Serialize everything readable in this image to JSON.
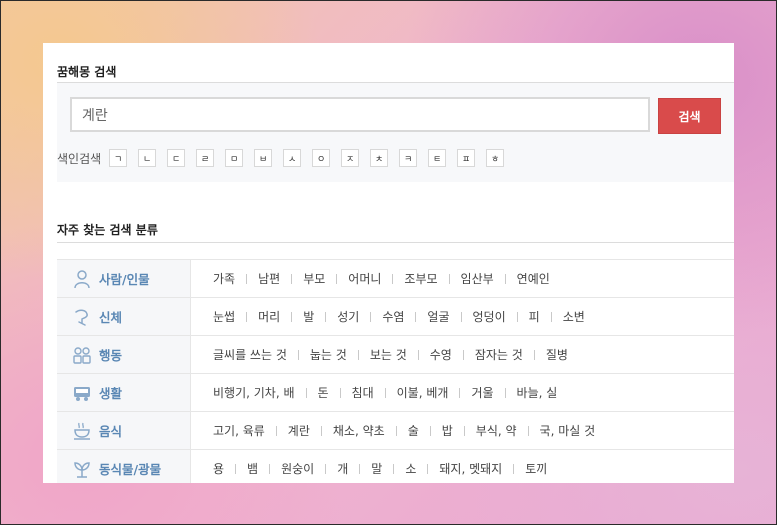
{
  "header": {
    "title": "꿈해몽 검색"
  },
  "search": {
    "value": "계란",
    "button_label": "검색"
  },
  "index": {
    "label": "색인검색",
    "keys": [
      "ㄱ",
      "ㄴ",
      "ㄷ",
      "ㄹ",
      "ㅁ",
      "ㅂ",
      "ㅅ",
      "ㅇ",
      "ㅈ",
      "ㅊ",
      "ㅋ",
      "ㅌ",
      "ㅍ",
      "ㅎ"
    ]
  },
  "categories_section": {
    "title": "자주 찾는 검색 분류"
  },
  "categories": [
    {
      "name": "사람/인물",
      "icon": "person-icon",
      "items": [
        "가족",
        "남편",
        "부모",
        "어머니",
        "조부모",
        "임산부",
        "연예인"
      ]
    },
    {
      "name": "신체",
      "icon": "body-icon",
      "items": [
        "눈썹",
        "머리",
        "발",
        "성기",
        "수염",
        "얼굴",
        "엉덩이",
        "피",
        "소변"
      ]
    },
    {
      "name": "행동",
      "icon": "people-icon",
      "items": [
        "글씨를 쓰는 것",
        "눕는 것",
        "보는 것",
        "수영",
        "잠자는 것",
        "질병"
      ]
    },
    {
      "name": "생활",
      "icon": "bus-icon",
      "items": [
        "비행기, 기차, 배",
        "돈",
        "침대",
        "이불, 베개",
        "거울",
        "바늘, 실"
      ]
    },
    {
      "name": "음식",
      "icon": "food-icon",
      "items": [
        "고기, 육류",
        "계란",
        "채소, 약초",
        "술",
        "밥",
        "부식, 약",
        "국, 마실 것"
      ]
    },
    {
      "name": "동식물/광물",
      "icon": "plant-icon",
      "items": [
        "용",
        "뱀",
        "원숭이",
        "개",
        "말",
        "소",
        "돼지, 멧돼지",
        "토끼"
      ]
    }
  ],
  "colors": {
    "accent": "#d94b4b",
    "category_text": "#5a87b4"
  }
}
